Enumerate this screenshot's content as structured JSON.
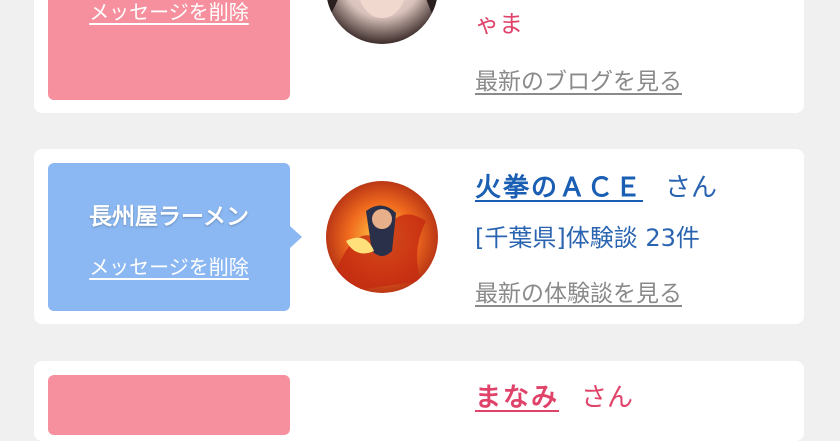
{
  "cards": [
    {
      "tag_link": "メッセージを削除",
      "name_tail": "ゃま",
      "latest_link": "最新のブログを見る",
      "tag_color": "#f7909e"
    },
    {
      "tag_title": "長州屋ラーメン",
      "tag_link": "メッセージを削除",
      "name": "火拳のＡＣＥ",
      "honorific": "さん",
      "meta": "[千葉県]体験談 23件",
      "latest_link": "最新の体験談を見る",
      "tag_color": "#8bb8f2"
    },
    {
      "name": "まなみ",
      "honorific": "さん",
      "tag_color": "#f7909e"
    }
  ],
  "colors": {
    "link_blue": "#1a5fb4",
    "accent_pink": "#e0436a",
    "gray_link": "#8a8a8a",
    "page_bg": "#f0f0f0"
  },
  "icons": [
    "user-avatar-photo",
    "user-avatar-fire-art"
  ]
}
